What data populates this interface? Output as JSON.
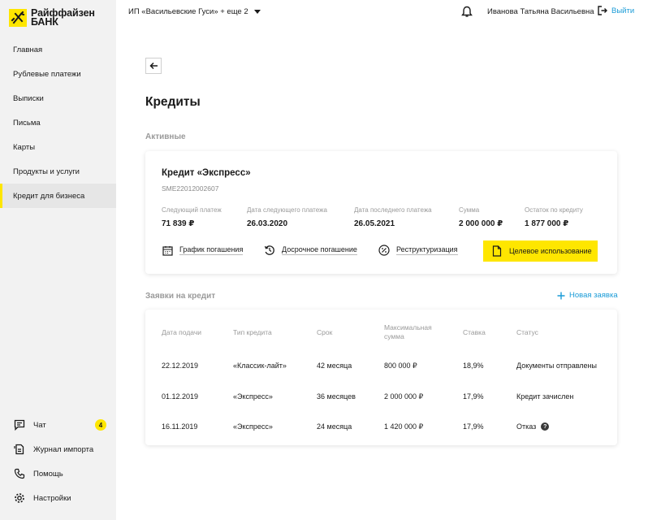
{
  "brand": {
    "line1": "Райффайзен",
    "line2": "БАНК",
    "accent_color": "#fee600",
    "link_color": "#1a9bd7"
  },
  "header": {
    "org_selector": "ИП «Васильевские Гуси» + еще 2",
    "user_name": "Иванова Татьяна Васильевна",
    "logout_label": "Выйти",
    "icons": [
      "bell-icon",
      "logout-icon",
      "chevron-down-icon"
    ]
  },
  "sidebar": {
    "items": [
      {
        "label": "Главная"
      },
      {
        "label": "Рублевые платежи"
      },
      {
        "label": "Выписки"
      },
      {
        "label": "Письма"
      },
      {
        "label": "Карты"
      },
      {
        "label": "Продукты и услуги"
      },
      {
        "label": "Кредит для бизнеса",
        "active": true
      }
    ],
    "bottom": [
      {
        "label": "Чат",
        "icon": "chat-icon",
        "badge": "4"
      },
      {
        "label": "Журнал импорта",
        "icon": "import-log-icon"
      },
      {
        "label": "Помощь",
        "icon": "phone-icon"
      },
      {
        "label": "Настройки",
        "icon": "gear-icon"
      }
    ]
  },
  "main": {
    "title": "Кредиты",
    "active_section": "Активные",
    "credit": {
      "name": "Кредит «Экспресс»",
      "id": "SME22012002607",
      "metrics": [
        {
          "label": "Следующий платеж",
          "value": "71 839 ₽"
        },
        {
          "label": "Дата следующего платежа",
          "value": "26.03.2020"
        },
        {
          "label": "Дата последнего платежа",
          "value": "26.05.2021"
        },
        {
          "label": "Сумма",
          "value": "2 000 000 ₽"
        },
        {
          "label": "Остаток по кредиту",
          "value": "1 877 000 ₽"
        }
      ],
      "actions": [
        {
          "label": "График погашения",
          "icon": "calendar-icon"
        },
        {
          "label": "Досрочное погашение",
          "icon": "clock-arrow-icon"
        },
        {
          "label": "Реструктуризация",
          "icon": "percent-icon"
        },
        {
          "label": "Целевое использование",
          "icon": "document-icon"
        }
      ]
    },
    "requests_section": "Заявки на кредит",
    "new_request_label": "Новая заявка",
    "requests_table": {
      "headers": [
        "Дата подачи",
        "Тип кредита",
        "Срок",
        "Максимальная сумма",
        "Ставка",
        "Статус"
      ],
      "rows": [
        [
          "22.12.2019",
          "«Классик-лайт»",
          "42 месяца",
          "800 000 ₽",
          "18,9%",
          "Документы отправлены"
        ],
        [
          "01.12.2019",
          "«Экспресс»",
          "36 месяцев",
          "2 000 000 ₽",
          "17,9%",
          "Кредит зачислен"
        ],
        [
          "16.11.2019",
          "«Экспресс»",
          "24 месяца",
          "1 420 000 ₽",
          "17,9%",
          "Отказ"
        ]
      ]
    }
  }
}
